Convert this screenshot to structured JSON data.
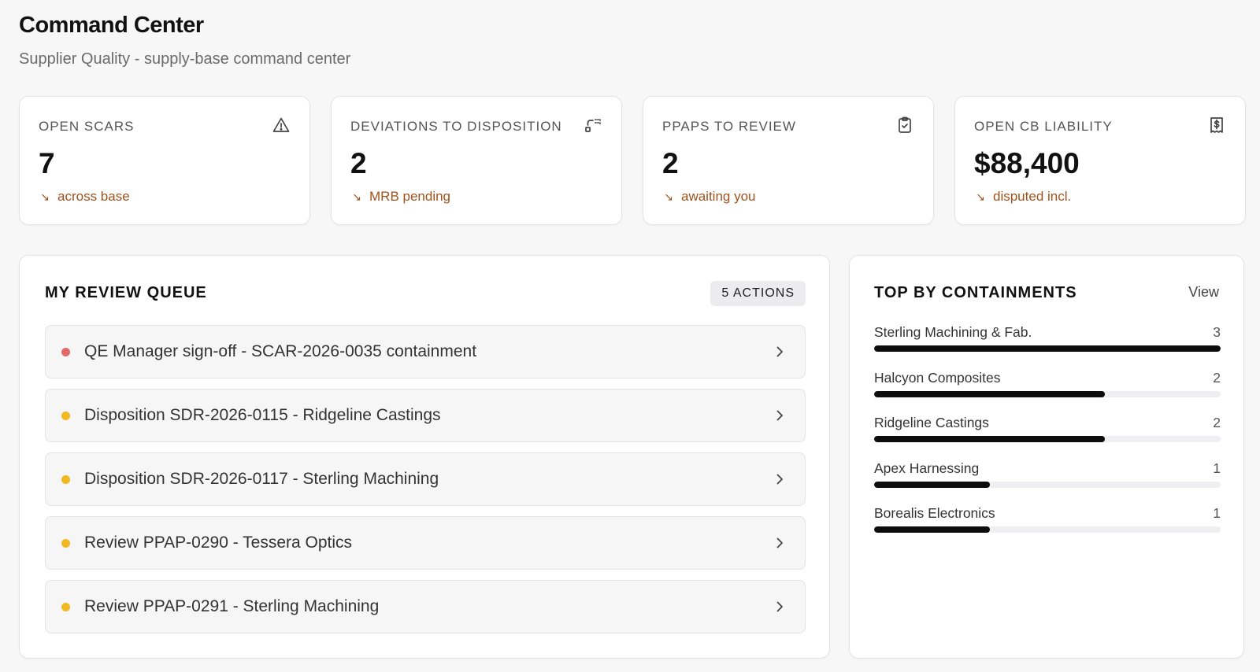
{
  "header": {
    "title": "Command Center",
    "subtitle": "Supplier Quality - supply-base command center"
  },
  "kpis": [
    {
      "label": "OPEN SCARS",
      "value": "7",
      "delta": "across base",
      "icon": "warning-triangle-icon"
    },
    {
      "label": "DEVIATIONS TO DISPOSITION",
      "value": "2",
      "delta": "MRB pending",
      "icon": "git-diff-icon"
    },
    {
      "label": "PPAPS TO REVIEW",
      "value": "2",
      "delta": "awaiting you",
      "icon": "clipboard-check-icon"
    },
    {
      "label": "OPEN CB LIABILITY",
      "value": "$88,400",
      "delta": "disputed incl.",
      "icon": "receipt-dollar-icon"
    }
  ],
  "delta_arrow": "↘",
  "queue": {
    "title": "MY REVIEW QUEUE",
    "badge": "5 ACTIONS",
    "items": [
      {
        "text": "QE Manager sign-off - SCAR-2026-0035 containment",
        "status_color": "#e46a6a"
      },
      {
        "text": "Disposition SDR-2026-0115 - Ridgeline Castings",
        "status_color": "#f2b824"
      },
      {
        "text": "Disposition SDR-2026-0117 - Sterling Machining",
        "status_color": "#f2b824"
      },
      {
        "text": "Review PPAP-0290 - Tessera Optics",
        "status_color": "#f2b824"
      },
      {
        "text": "Review PPAP-0291 - Sterling Machining",
        "status_color": "#f2b824"
      }
    ]
  },
  "top_containments": {
    "title": "TOP BY CONTAINMENTS",
    "view_label": "View",
    "max": 3,
    "items": [
      {
        "name": "Sterling Machining & Fab.",
        "count": 3
      },
      {
        "name": "Halcyon Composites",
        "count": 2
      },
      {
        "name": "Ridgeline Castings",
        "count": 2
      },
      {
        "name": "Apex Harnessing",
        "count": 1
      },
      {
        "name": "Borealis Electronics",
        "count": 1
      }
    ]
  },
  "colors": {
    "accent_delta": "#a0521c",
    "bar_fill": "#0d0d0d",
    "critical": "#e46a6a",
    "warning": "#f2b824"
  }
}
